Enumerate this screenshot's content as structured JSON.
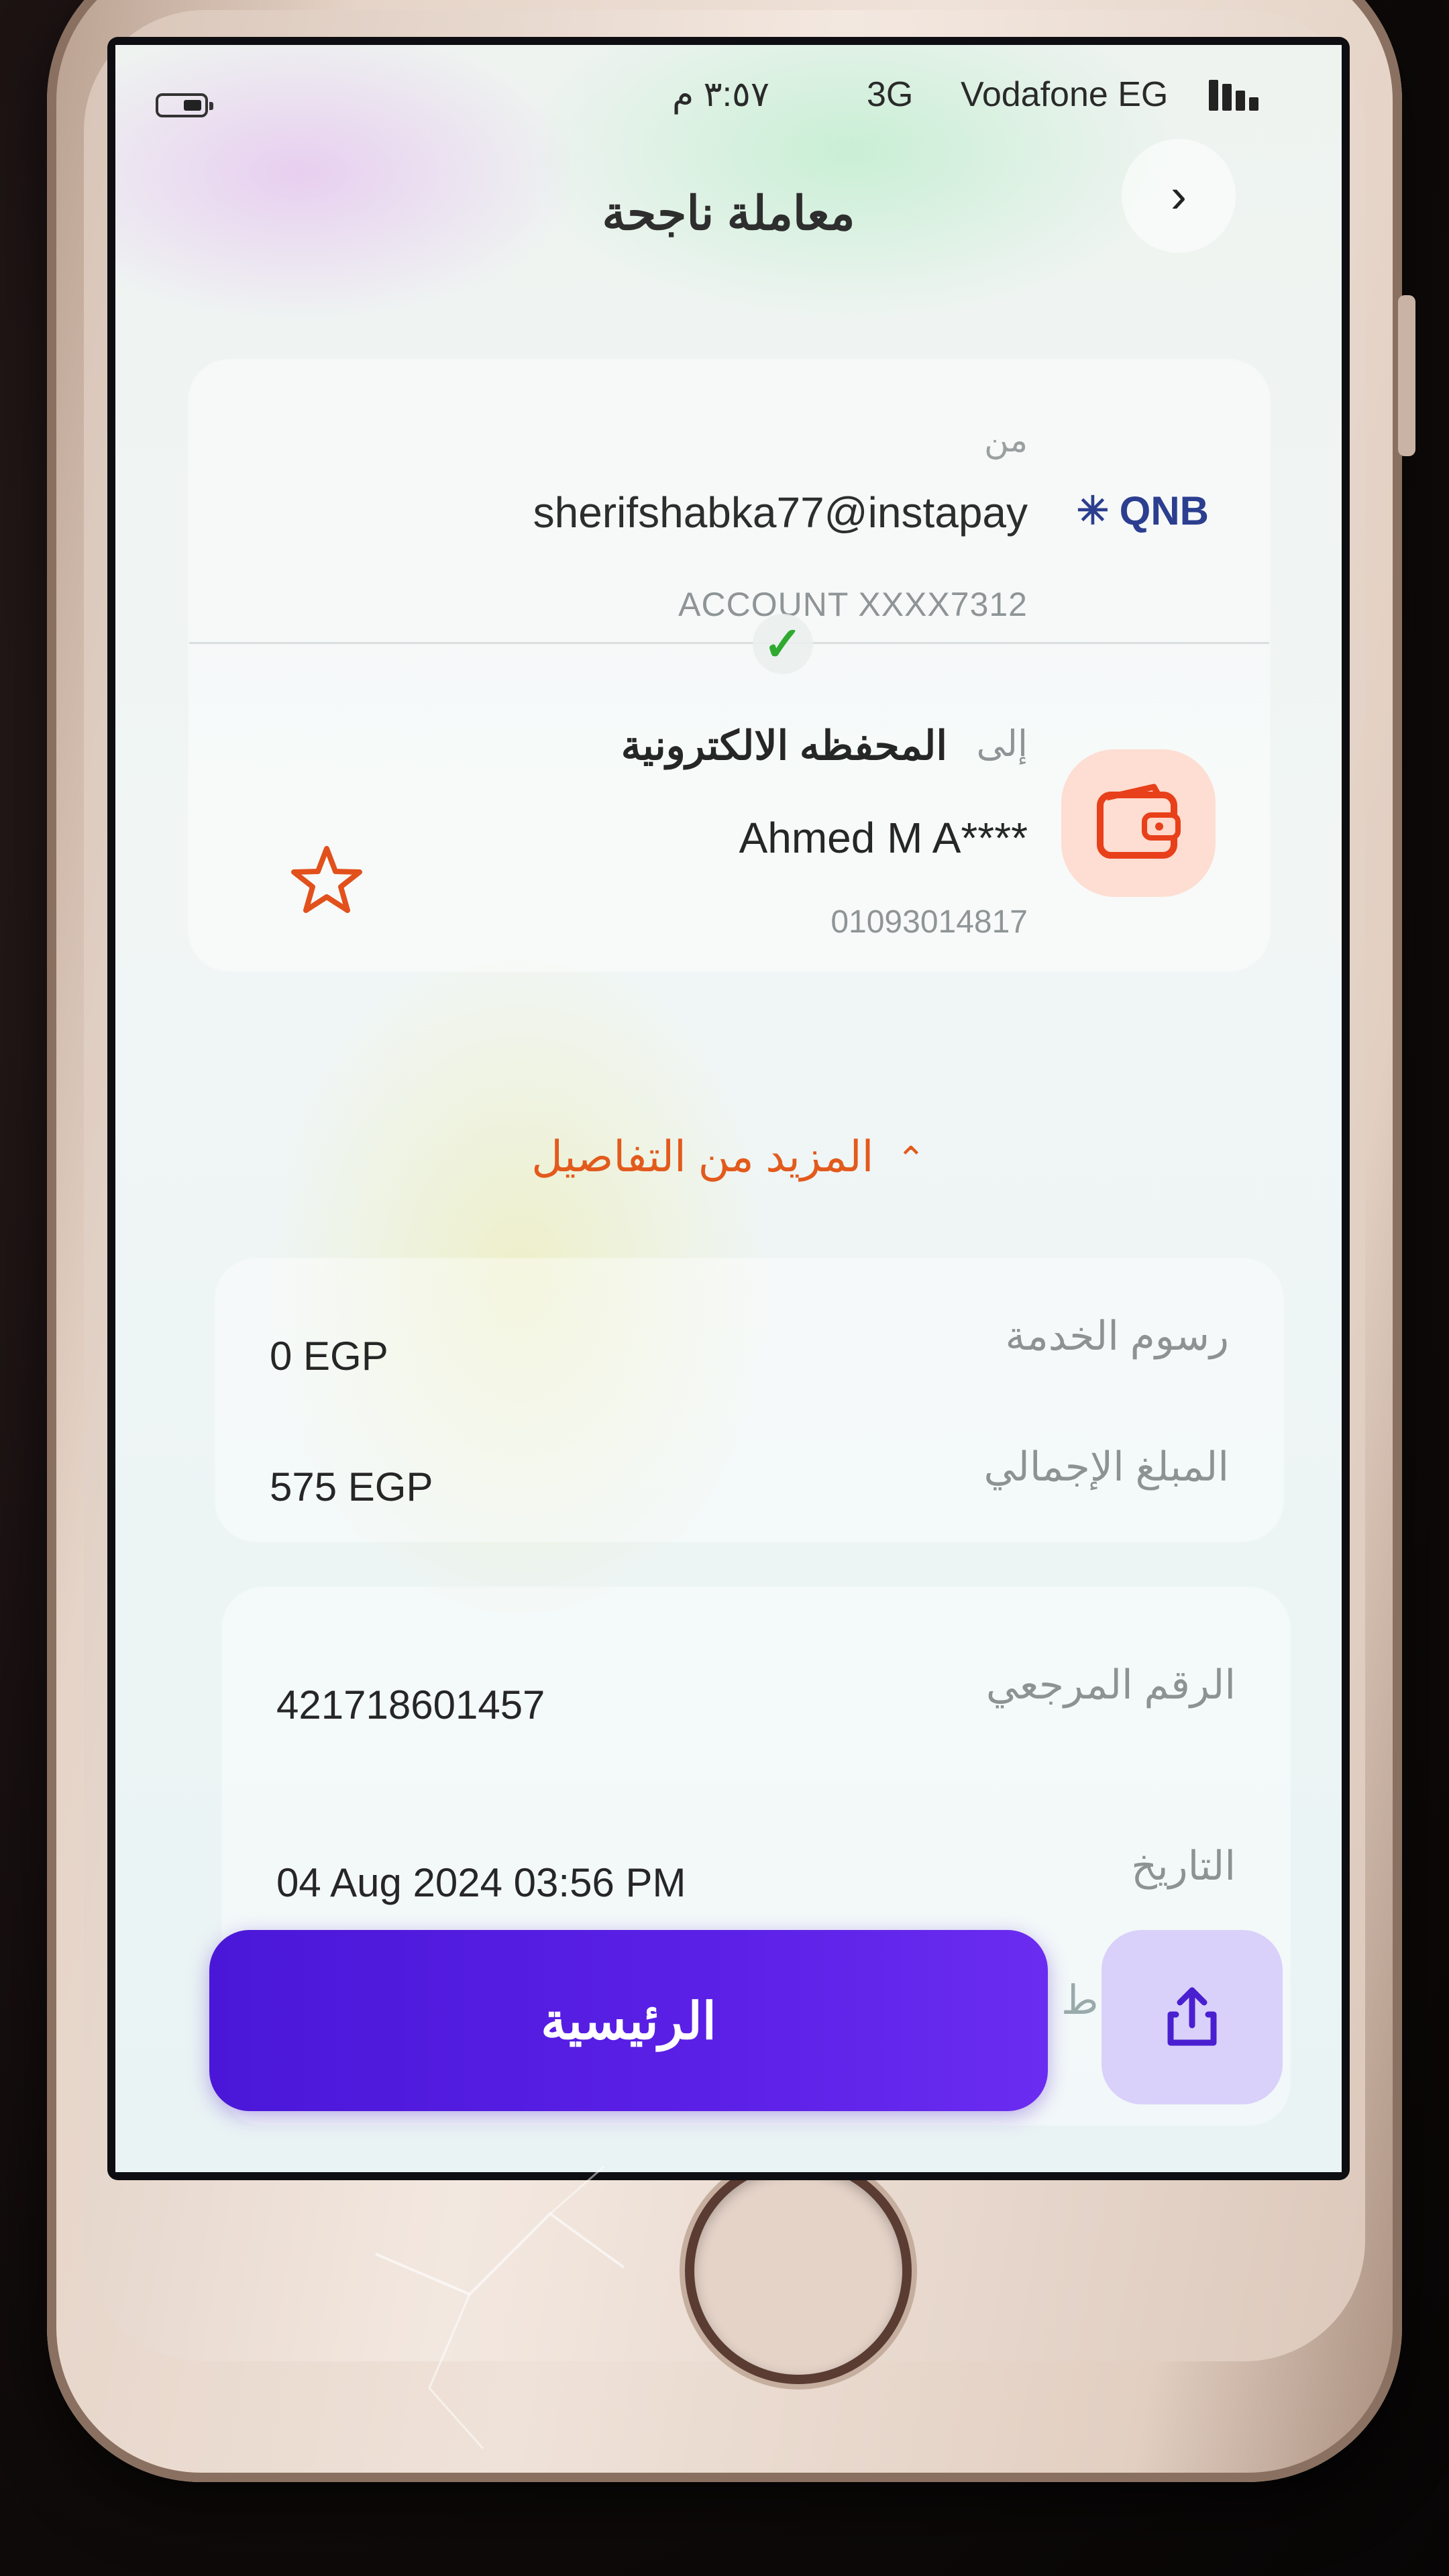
{
  "status_bar": {
    "time": "٣:٥٧ م",
    "network": "3G",
    "carrier": "Vodafone EG"
  },
  "header": {
    "title": "معاملة ناجحة",
    "subtitle": "",
    "back_icon": "chevron-right-icon"
  },
  "transfer": {
    "from_label": "من",
    "sender_address": "sherifshabka77@instapay",
    "bank_name": "QNB",
    "account_label": "ACCOUNT  XXXX7312",
    "status_icon": "check-icon",
    "to_label": "إلى",
    "destination_type": "المحفظه الالكترونية",
    "recipient_name": "Ahmed M A****",
    "recipient_phone": "01093014817",
    "wallet_icon": "wallet-icon",
    "favorite_icon": "star-icon"
  },
  "details_toggle": {
    "label": "المزيد من التفاصيل"
  },
  "fees": {
    "service_fee_label": "رسوم الخدمة",
    "service_fee_value": "0 EGP",
    "total_label": "المبلغ الإجمالي",
    "total_value": "575 EGP"
  },
  "reference": {
    "reference_label": "الرقم المرجعي",
    "reference_value": "421718601457",
    "date_label": "التاريخ",
    "date_value": "04 Aug 2024 03:56 PM",
    "partial_label": "ط"
  },
  "actions": {
    "home_label": "الرئيسية",
    "share_icon": "share-icon"
  },
  "colors": {
    "primary": "#5b20e6",
    "accent": "#e25a1c",
    "success": "#2faa2f"
  }
}
